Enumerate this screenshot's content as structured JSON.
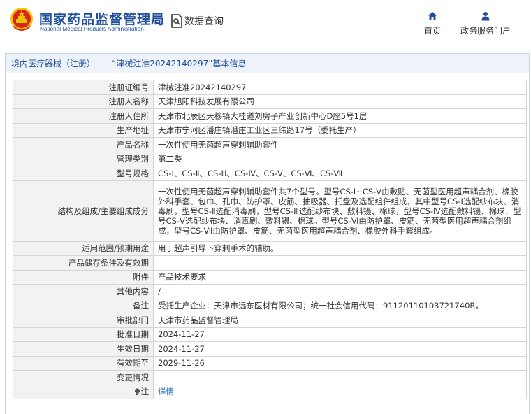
{
  "header": {
    "site_title": "国家药品监督管理局",
    "site_subtitle": "National Medical Products Administration",
    "query_title": "数据查询",
    "nav": [
      {
        "label": "首页",
        "icon": "home-icon"
      },
      {
        "label": "政务服务门户",
        "icon": "person-icon"
      }
    ]
  },
  "panel": {
    "breadcrumb_link": "境内医疗器械（注册）",
    "title_rest": "——“津械注准20242140297”基本信息"
  },
  "fields": [
    {
      "label": "注册证编号",
      "value": "津械注准20242140297"
    },
    {
      "label": "注册人名称",
      "value": "天津旭阳科技发展有限公司"
    },
    {
      "label": "注册人住所",
      "value": "天津市北辰区天穆镇大桂道刘房子产业创新中心D座5号1层"
    },
    {
      "label": "生产地址",
      "value": "天津市宁河区潘庄镇潘庄工业区三纬路17号（委托生产）"
    },
    {
      "label": "产品名称",
      "value": "一次性使用无菌超声穿刺辅助套件"
    },
    {
      "label": "管理类别",
      "value": "第二类"
    },
    {
      "label": "型号规格",
      "value": "CS-Ⅰ、CS-Ⅱ、CS-Ⅲ、CS-Ⅳ、CS-Ⅴ、CS-Ⅵ、CS-Ⅶ"
    },
    {
      "label": "结构及组成/主要组成成分",
      "value": "一次性使用无菌超声穿刺辅助套件共7个型号。型号CS-Ⅰ~CS-Ⅴ由敷贴、无菌型医用超声耦合剂、橡胶外科手套、包巾、孔巾、防护罩、皮筋、抽吸器、托盘及选配组件组成，其中型号CS-Ⅰ选配纱布块、消毒刷，型号CS-Ⅱ选配消毒刷，型号CS-Ⅲ选配纱布块、敷料镊、棉球，型号CS-Ⅳ选配敷料镊、棉球，型号CS-Ⅴ选配纱布块、消毒刷、敷料镊、棉球。型号CS-Ⅵ由防护罩、皮筋、无菌型医用超声耦合剂组成，型号CS-Ⅶ由防护罩、皮筋、无菌型医用超声耦合剂、橡胶外科手套组成。"
    },
    {
      "label": "适用范围/预期用途",
      "value": "用于超声引导下穿刺手术的辅助。"
    },
    {
      "label": "产品储存条件及有效期",
      "value": ""
    },
    {
      "label": "附件",
      "value": "产品技术要求"
    },
    {
      "label": "其他内容",
      "value": "/"
    },
    {
      "label": "备注",
      "value": "受托生产企业：天津市远东医材有限公司；统一社会信用代码：91120110103721740R。"
    },
    {
      "label": "审批部门",
      "value": "天津市药品监督管理局"
    },
    {
      "label": "批准日期",
      "value": "2024-11-27"
    },
    {
      "label": "生效日期",
      "value": "2024-11-27"
    },
    {
      "label": "有效期至",
      "value": "2029-11-26"
    },
    {
      "label": "变更情况",
      "value": ""
    },
    {
      "label": "注",
      "value": "详情",
      "icon": "lightbulb-icon"
    }
  ],
  "colors": {
    "brand": "#1d4f9c",
    "link": "#1d6fd0",
    "label_bg": "#f2f2f2",
    "emblem_red": "#d8261c",
    "emblem_gold": "#f3c300"
  }
}
